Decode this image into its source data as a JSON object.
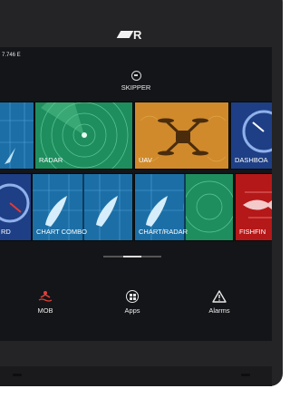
{
  "header": {
    "coordinate": "7.746 E",
    "brand_logo": "R"
  },
  "profile": {
    "name": "SKIPPER",
    "icon": "steering-wheel-icon"
  },
  "apps": [
    {
      "label": "",
      "icon": "navigation-chart-icon"
    },
    {
      "label": "RADAR",
      "icon": "radar-icon"
    },
    {
      "label": "UAV",
      "icon": "drone-icon"
    },
    {
      "label": "DASHBOA",
      "icon": "gauge-icon"
    },
    {
      "label": "RD",
      "icon": "gauge-icon"
    },
    {
      "label": "CHART COMBO",
      "icon": "chart-combo-icon"
    },
    {
      "label": "CHART/RADAR",
      "icon": "chart-radar-icon"
    },
    {
      "label": "FISHFIN",
      "icon": "fishfinder-icon"
    }
  ],
  "pager": {
    "pages": 2,
    "current": 1
  },
  "bottom_bar": {
    "mob": {
      "label": "MOB",
      "color": "#e0403a",
      "icon": "man-overboard-icon"
    },
    "apps": {
      "label": "Apps",
      "icon": "apps-grid-icon"
    },
    "alarms": {
      "label": "Alarms",
      "icon": "alarm-triangle-icon"
    }
  }
}
